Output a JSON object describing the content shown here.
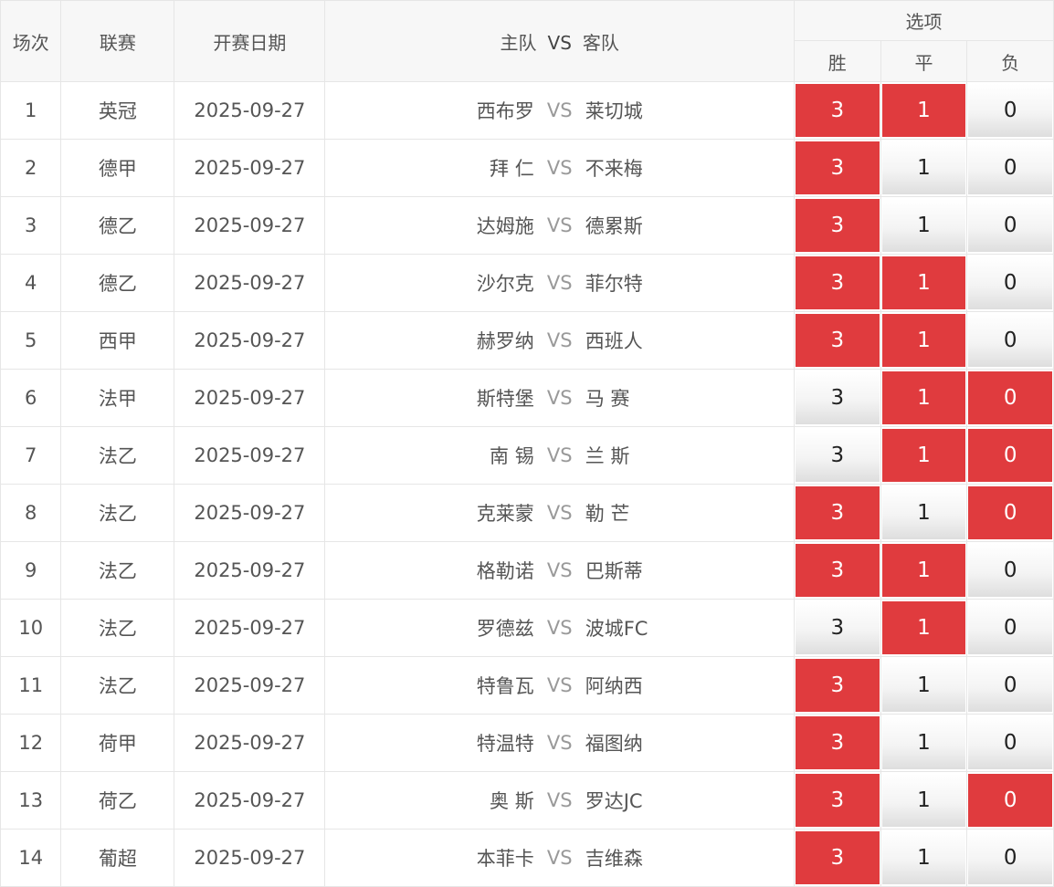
{
  "header": {
    "idx": "场次",
    "league": "联赛",
    "date": "开赛日期",
    "home": "主队",
    "vs": "VS",
    "away": "客队",
    "options": "选项",
    "win": "胜",
    "draw": "平",
    "lose": "负"
  },
  "colors": {
    "selected": "#e03b3e",
    "unselected": "#f2f2f2"
  },
  "matches": [
    {
      "idx": "1",
      "league": "英冠",
      "date": "2025-09-27",
      "home": "西布罗",
      "vs": "VS",
      "away": "莱切城",
      "win": "3",
      "draw": "1",
      "lose": "0",
      "selected": {
        "win": true,
        "draw": true,
        "lose": false
      }
    },
    {
      "idx": "2",
      "league": "德甲",
      "date": "2025-09-27",
      "home": "拜 仁",
      "vs": "VS",
      "away": "不来梅",
      "win": "3",
      "draw": "1",
      "lose": "0",
      "selected": {
        "win": true,
        "draw": false,
        "lose": false
      }
    },
    {
      "idx": "3",
      "league": "德乙",
      "date": "2025-09-27",
      "home": "达姆施",
      "vs": "VS",
      "away": "德累斯",
      "win": "3",
      "draw": "1",
      "lose": "0",
      "selected": {
        "win": true,
        "draw": false,
        "lose": false
      }
    },
    {
      "idx": "4",
      "league": "德乙",
      "date": "2025-09-27",
      "home": "沙尔克",
      "vs": "VS",
      "away": "菲尔特",
      "win": "3",
      "draw": "1",
      "lose": "0",
      "selected": {
        "win": true,
        "draw": true,
        "lose": false
      }
    },
    {
      "idx": "5",
      "league": "西甲",
      "date": "2025-09-27",
      "home": "赫罗纳",
      "vs": "VS",
      "away": "西班人",
      "win": "3",
      "draw": "1",
      "lose": "0",
      "selected": {
        "win": true,
        "draw": true,
        "lose": false
      }
    },
    {
      "idx": "6",
      "league": "法甲",
      "date": "2025-09-27",
      "home": "斯特堡",
      "vs": "VS",
      "away": "马 赛",
      "win": "3",
      "draw": "1",
      "lose": "0",
      "selected": {
        "win": false,
        "draw": true,
        "lose": true
      }
    },
    {
      "idx": "7",
      "league": "法乙",
      "date": "2025-09-27",
      "home": "南 锡",
      "vs": "VS",
      "away": "兰 斯",
      "win": "3",
      "draw": "1",
      "lose": "0",
      "selected": {
        "win": false,
        "draw": true,
        "lose": true
      }
    },
    {
      "idx": "8",
      "league": "法乙",
      "date": "2025-09-27",
      "home": "克莱蒙",
      "vs": "VS",
      "away": "勒 芒",
      "win": "3",
      "draw": "1",
      "lose": "0",
      "selected": {
        "win": true,
        "draw": false,
        "lose": true
      }
    },
    {
      "idx": "9",
      "league": "法乙",
      "date": "2025-09-27",
      "home": "格勒诺",
      "vs": "VS",
      "away": "巴斯蒂",
      "win": "3",
      "draw": "1",
      "lose": "0",
      "selected": {
        "win": true,
        "draw": true,
        "lose": false
      }
    },
    {
      "idx": "10",
      "league": "法乙",
      "date": "2025-09-27",
      "home": "罗德兹",
      "vs": "VS",
      "away": "波城FC",
      "win": "3",
      "draw": "1",
      "lose": "0",
      "selected": {
        "win": false,
        "draw": true,
        "lose": false
      }
    },
    {
      "idx": "11",
      "league": "法乙",
      "date": "2025-09-27",
      "home": "特鲁瓦",
      "vs": "VS",
      "away": "阿纳西",
      "win": "3",
      "draw": "1",
      "lose": "0",
      "selected": {
        "win": true,
        "draw": false,
        "lose": false
      }
    },
    {
      "idx": "12",
      "league": "荷甲",
      "date": "2025-09-27",
      "home": "特温特",
      "vs": "VS",
      "away": "福图纳",
      "win": "3",
      "draw": "1",
      "lose": "0",
      "selected": {
        "win": true,
        "draw": false,
        "lose": false
      }
    },
    {
      "idx": "13",
      "league": "荷乙",
      "date": "2025-09-27",
      "home": "奥 斯",
      "vs": "VS",
      "away": "罗达JC",
      "win": "3",
      "draw": "1",
      "lose": "0",
      "selected": {
        "win": true,
        "draw": false,
        "lose": true
      }
    },
    {
      "idx": "14",
      "league": "葡超",
      "date": "2025-09-27",
      "home": "本菲卡",
      "vs": "VS",
      "away": "吉维森",
      "win": "3",
      "draw": "1",
      "lose": "0",
      "selected": {
        "win": true,
        "draw": false,
        "lose": false
      }
    }
  ]
}
